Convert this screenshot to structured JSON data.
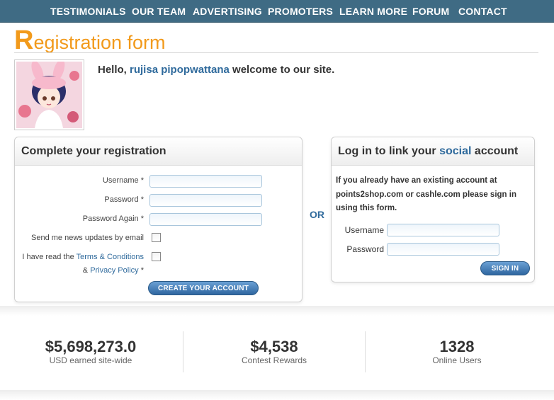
{
  "nav": {
    "items": [
      "TESTIMONIALS",
      "OUR TEAM",
      "ADVERTISING",
      "PROMOTERS",
      "LEARN MORE",
      "FORUM",
      "CONTACT"
    ]
  },
  "page": {
    "title_first": "R",
    "title_rest": "egistration form",
    "hello_prefix": "Hello, ",
    "username": "rujisa pipopwattana",
    "hello_suffix": " welcome to our site."
  },
  "registration": {
    "heading": "Complete your registration",
    "username_label": "Username *",
    "password_label": "Password *",
    "password_again_label": "Password Again *",
    "news_label": "Send me news updates by email",
    "terms_prefix": "I have read the ",
    "terms_link": "Terms & Conditions",
    "and_text": "& ",
    "privacy_link": "Privacy Policy",
    "privacy_suffix": " *",
    "submit_label": "CREATE YOUR ACCOUNT"
  },
  "or_label": "OR",
  "login": {
    "heading_prefix": "Log in to link your ",
    "heading_accent": "social",
    "heading_suffix": " account",
    "note": "If you already have an existing account at points2shop.com or cashle.com please sign in using this form.",
    "username_label": "Username",
    "password_label": "Password",
    "signin_label": "SIGN IN"
  },
  "stats": [
    {
      "value": "$5,698,273.0",
      "label": "USD earned site-wide"
    },
    {
      "value": "$4,538",
      "label": "Contest Rewards"
    },
    {
      "value": "1328",
      "label": "Online Users"
    }
  ],
  "colors": {
    "nav_bg": "#3f6b84",
    "title_orange": "#f29a1b",
    "link_blue": "#2f6a9c",
    "button_blue": "#2f66a0"
  }
}
